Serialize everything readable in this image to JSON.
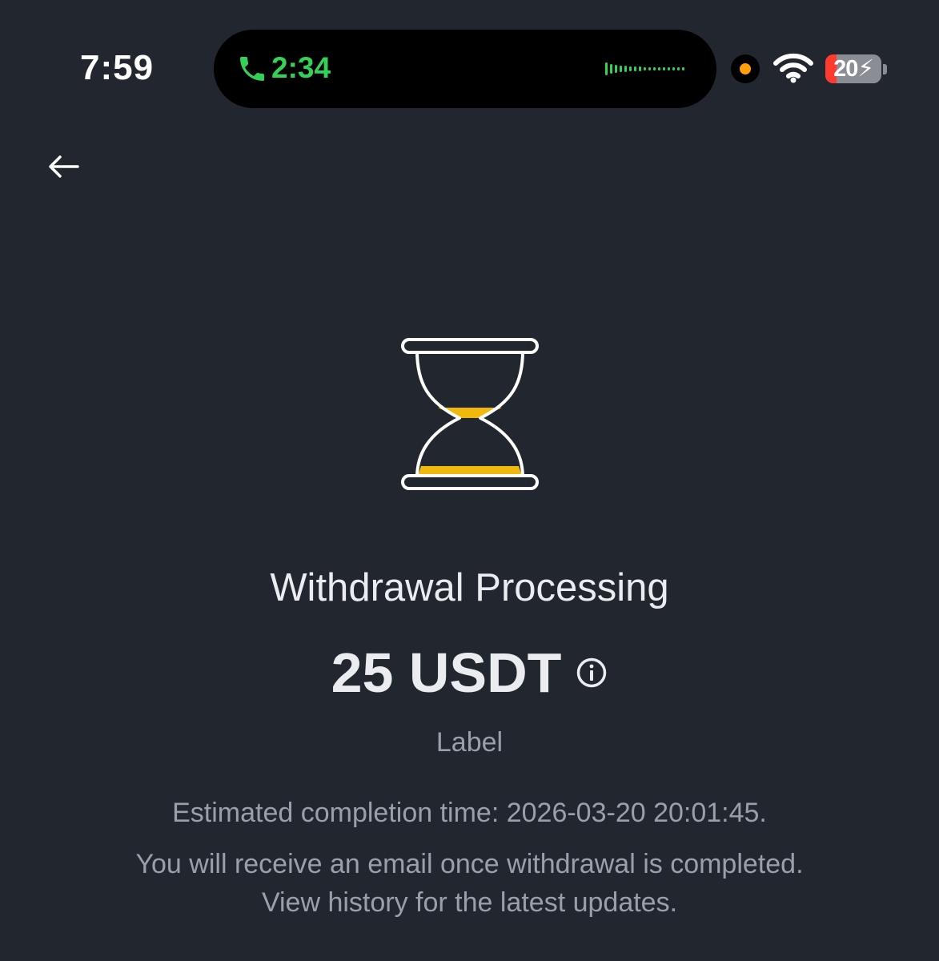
{
  "status_bar": {
    "time": "7:59",
    "call_timer": "2:34",
    "battery_level": "20",
    "battery_charging": true,
    "accent_call": "#34d158",
    "accent_recording": "#ff9f0a",
    "battery_low_color": "#ff3b30"
  },
  "nav": {
    "back_icon": "arrow-left-icon"
  },
  "status_icon": {
    "name": "hourglass-icon",
    "accent": "#f0b90b"
  },
  "main": {
    "title": "Withdrawal Processing",
    "amount": "25 USDT",
    "label": "Label",
    "estimated_completion": "Estimated completion time: 2026-03-20 20:01:45.",
    "email_notice_line1": "You will receive an email once withdrawal is completed.",
    "email_notice_line2": "View history for the latest updates."
  },
  "colors": {
    "background": "#22262f",
    "primary_text": "#eaecef",
    "secondary_text": "#9aa0aa"
  }
}
